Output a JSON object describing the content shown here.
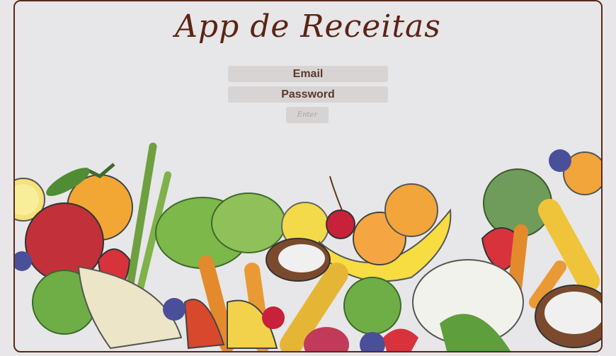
{
  "app": {
    "title": "App de Receitas"
  },
  "login": {
    "email_placeholder": "Email",
    "password_placeholder": "Password",
    "enter_label": "Enter"
  },
  "colors": {
    "frame_border": "#5a2a1a",
    "title": "#5b2414",
    "field_bg": "#d9d4d4"
  },
  "illustration": {
    "icon": "vegetables-fruits-illustration"
  }
}
